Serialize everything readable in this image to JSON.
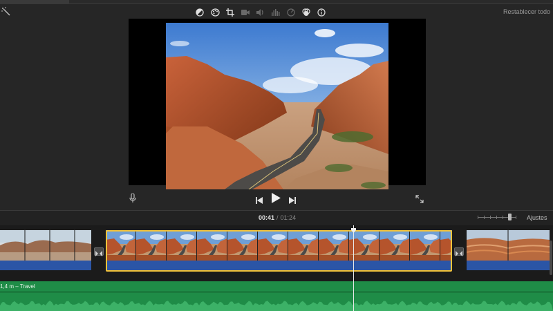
{
  "toolbar": {
    "reset_label": "Restablecer todo",
    "icons": [
      "balance-color",
      "color-correction",
      "crop",
      "stabilization",
      "volume",
      "noise-reduction",
      "speed",
      "clip-filter",
      "info"
    ]
  },
  "playback": {
    "current_time": "00:41",
    "separator": "/",
    "total_time": "01:24"
  },
  "timeline": {
    "adjust_label": "Ajustes",
    "music_label": "1,4 m – Travel"
  },
  "colors": {
    "selection": "#f3c33a",
    "audio": "#2b55a6",
    "music": "#1f8c47"
  }
}
